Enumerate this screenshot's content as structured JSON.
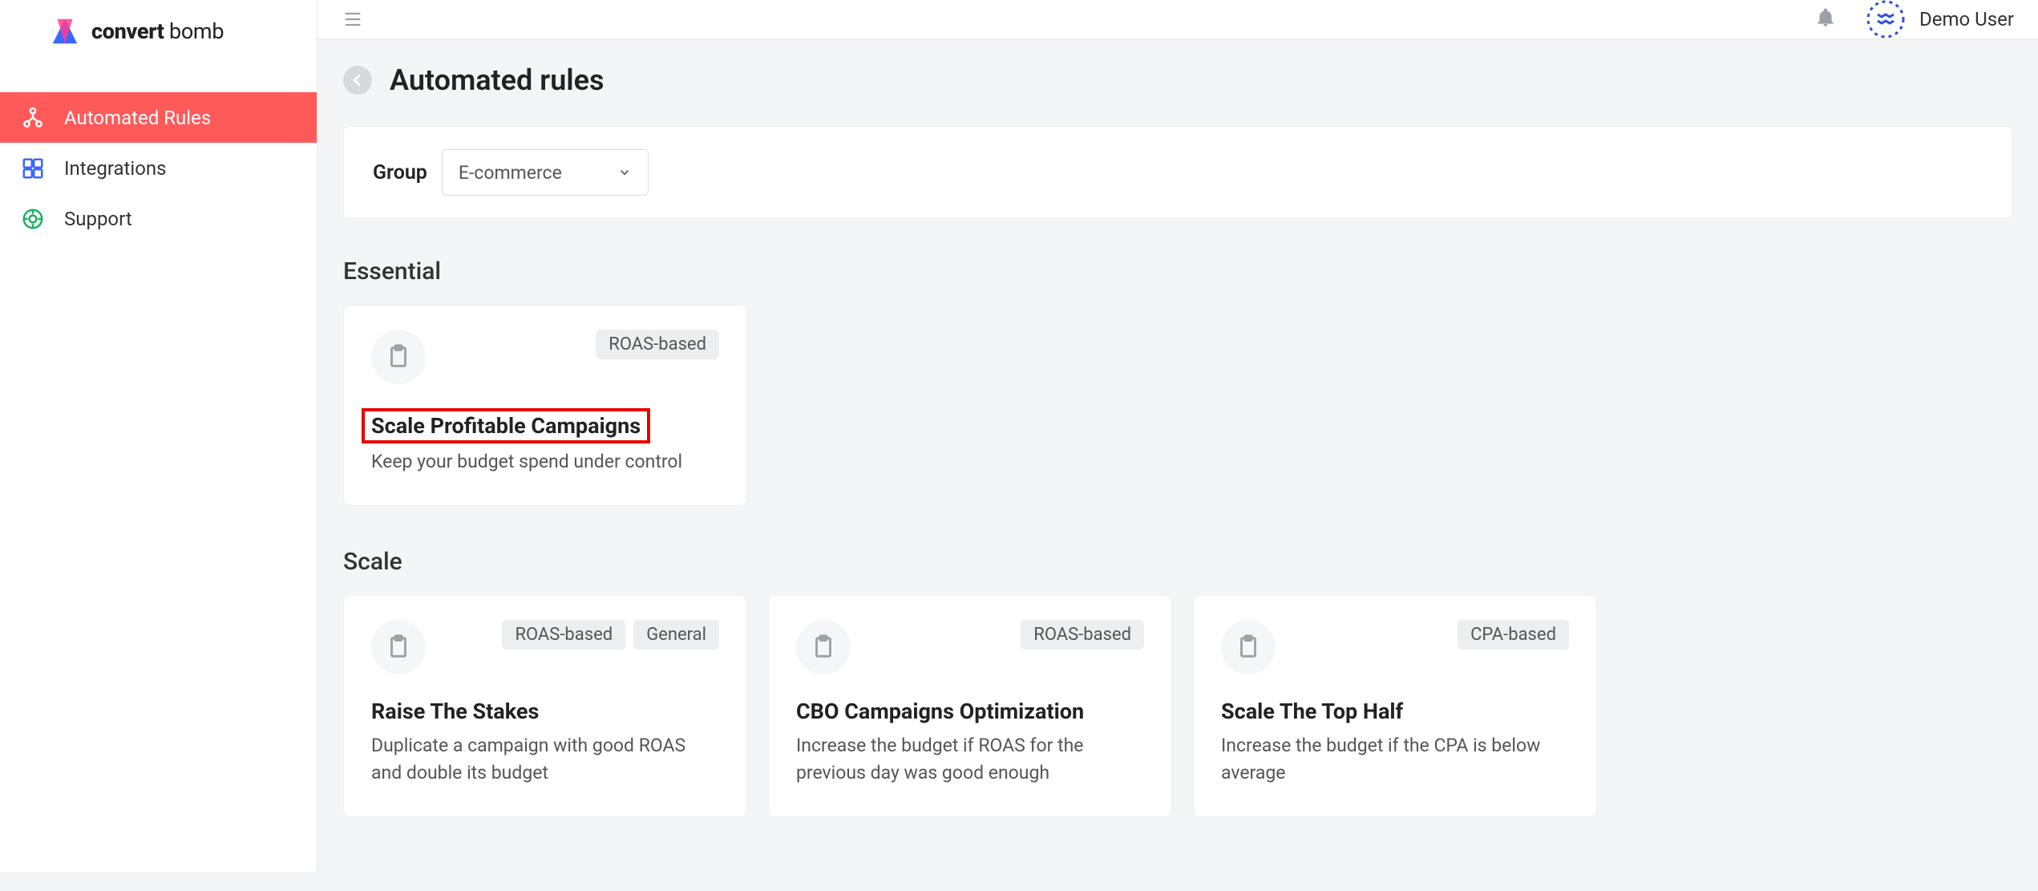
{
  "brand": {
    "bold": "convert",
    "rest": " bomb"
  },
  "nav": {
    "items": [
      {
        "label": "Automated Rules"
      },
      {
        "label": "Integrations"
      },
      {
        "label": "Support"
      }
    ]
  },
  "user": {
    "name": "Demo User"
  },
  "page": {
    "title": "Automated rules"
  },
  "group": {
    "label": "Group",
    "selected": "E-commerce"
  },
  "sections": {
    "essential": {
      "title": "Essential",
      "cards": [
        {
          "badges": [
            "ROAS-based"
          ],
          "title": "Scale Profitable Campaigns",
          "sub": "Keep your budget spend under control"
        }
      ]
    },
    "scale": {
      "title": "Scale",
      "cards": [
        {
          "badges": [
            "ROAS-based",
            "General"
          ],
          "title": "Raise The Stakes",
          "sub": "Duplicate a campaign with good ROAS and double its budget"
        },
        {
          "badges": [
            "ROAS-based"
          ],
          "title": "CBO Campaigns Optimization",
          "sub": "Increase the budget if ROAS for the previous day was good enough"
        },
        {
          "badges": [
            "CPA-based"
          ],
          "title": "Scale The Top Half",
          "sub": "Increase the budget if the CPA is below average"
        }
      ]
    }
  }
}
